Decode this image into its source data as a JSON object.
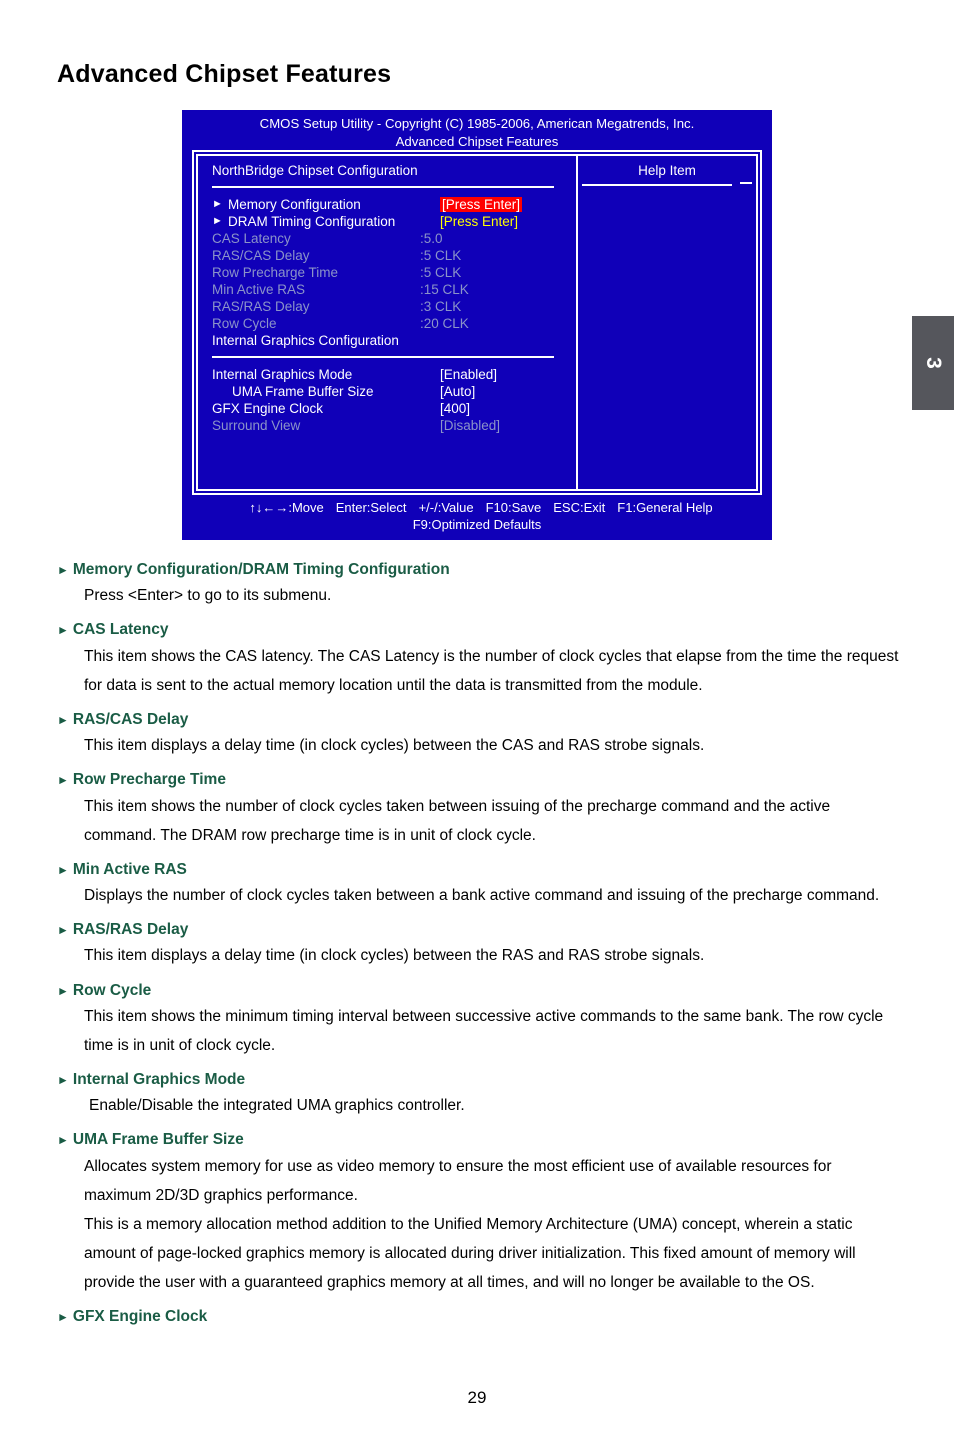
{
  "page": {
    "title": "Advanced Chipset Features",
    "number": "29",
    "chapter_tab": "3"
  },
  "bios": {
    "title_line1": "CMOS Setup Utility - Copyright (C) 1985-2006, American Megatrends, Inc.",
    "title_line2": "Advanced Chipset Features",
    "left_panel_heading": "NorthBridge Chipset Configuration",
    "help_panel_heading": "Help Item",
    "graphics_heading": "Internal Graphics Configuration",
    "colors": {
      "screen_bg": "#1000b8",
      "highlight_bg": "#ff0000",
      "highlight_text": "#ffffff",
      "yellow_value": "#ffff00",
      "disabled_text": "#8b93c9",
      "heading_green": "#1a5c45",
      "tab_gray": "#55565c"
    },
    "memory_rows": [
      {
        "label": "Memory Configuration",
        "value": "[Press Enter]",
        "style": "highlight",
        "arrow": true
      },
      {
        "label": "DRAM Timing Configuration",
        "value": "[Press Enter]",
        "style": "yellow",
        "arrow": true
      },
      {
        "label": "CAS Latency",
        "value": ":5.0",
        "style": "dim",
        "arrow": false
      },
      {
        "label": "RAS/CAS Delay",
        "value": ":5 CLK",
        "style": "dim",
        "arrow": false
      },
      {
        "label": "Row Precharge Time",
        "value": ":5 CLK",
        "style": "dim",
        "arrow": false
      },
      {
        "label": "Min Active RAS",
        "value": ":15 CLK",
        "style": "dim",
        "arrow": false
      },
      {
        "label": "RAS/RAS Delay",
        "value": ":3 CLK",
        "style": "dim",
        "arrow": false
      },
      {
        "label": "Row Cycle",
        "value": ":20 CLK",
        "style": "dim",
        "arrow": false
      }
    ],
    "graphics_rows": [
      {
        "label": "Internal Graphics Mode",
        "value": "[Enabled]",
        "style": "normal",
        "sub": false
      },
      {
        "label": "UMA Frame Buffer Size",
        "value": "[Auto]",
        "style": "normal",
        "sub": true
      },
      {
        "label": "GFX Engine Clock",
        "value": "[400]",
        "style": "normal",
        "sub": false
      },
      {
        "label": "Surround View",
        "value": "[Disabled]",
        "style": "dim",
        "sub": false
      }
    ],
    "footer_keys": [
      "↑↓←→:Move",
      "Enter:Select",
      "+/-/:Value",
      "F10:Save",
      "ESC:Exit",
      "F1:General Help"
    ],
    "footer_line2": "F9:Optimized Defaults"
  },
  "sections": [
    {
      "heading": "Memory Configuration/DRAM Timing Configuration",
      "paragraphs": [
        "Press <Enter> to go to its submenu."
      ]
    },
    {
      "heading": "CAS Latency",
      "paragraphs": [
        "This item shows the CAS latency. The CAS Latency is the number of clock cycles that elapse from the time the request for data is sent to the actual memory location until the data is transmitted from the module."
      ]
    },
    {
      "heading": "RAS/CAS Delay",
      "paragraphs": [
        "This item displays a delay time (in clock cycles) between the CAS and RAS strobe signals."
      ]
    },
    {
      "heading": "Row Precharge Time",
      "paragraphs": [
        "This item shows the number of clock cycles taken between issuing of the precharge command and the active command. The DRAM row precharge time is in unit of clock cycle."
      ]
    },
    {
      "heading": "Min Active RAS",
      "paragraphs": [
        "Displays the number of clock cycles taken between a bank active command and issuing of the precharge command."
      ]
    },
    {
      "heading": "RAS/RAS Delay",
      "paragraphs": [
        "This item displays a delay time (in clock cycles) between the RAS and RAS strobe signals."
      ]
    },
    {
      "heading": "Row Cycle",
      "paragraphs": [
        "This item shows the minimum timing interval between successive active commands to the same bank. The row cycle time is in unit of clock cycle."
      ]
    },
    {
      "heading": "Internal Graphics Mode",
      "paragraphs": [
        " Enable/Disable the integrated UMA graphics controller."
      ]
    },
    {
      "heading": "UMA Frame Buffer Size",
      "paragraphs": [
        "Allocates system memory for use as video memory to ensure the most efficient use of available resources for maximum 2D/3D graphics performance.",
        "This is a memory allocation method addition to the Unified Memory Architecture (UMA) concept, wherein a static amount of page-locked graphics memory is allocated during driver initialization. This fixed amount of memory will provide the user with a guaranteed graphics memory at all times, and will no longer be available to the OS."
      ]
    },
    {
      "heading": "GFX Engine Clock",
      "paragraphs": []
    }
  ]
}
